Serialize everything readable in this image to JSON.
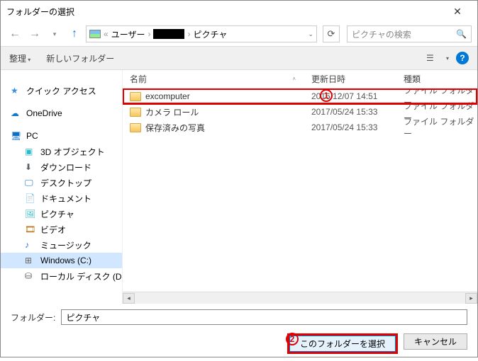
{
  "window": {
    "title": "フォルダーの選択"
  },
  "nav": {
    "path_prefix": "«",
    "path_group": "ユーザー",
    "path_sep": "›",
    "path_current": "ピクチャ",
    "search_placeholder": "ピクチャの検索"
  },
  "toolbar": {
    "organize": "整理",
    "new_folder": "新しいフォルダー",
    "help": "?"
  },
  "columns": {
    "name": "名前",
    "date": "更新日時",
    "type": "種類"
  },
  "tree": [
    {
      "icon": "star",
      "label": "クイック アクセス",
      "indent": 0
    },
    {
      "icon": "cloud",
      "label": "OneDrive",
      "indent": 0,
      "gap": true
    },
    {
      "icon": "pc",
      "label": "PC",
      "indent": 0,
      "gap": true
    },
    {
      "icon": "obj3d",
      "label": "3D オブジェクト",
      "indent": 1
    },
    {
      "icon": "download",
      "label": "ダウンロード",
      "indent": 1
    },
    {
      "icon": "desktop",
      "label": "デスクトップ",
      "indent": 1
    },
    {
      "icon": "doc",
      "label": "ドキュメント",
      "indent": 1
    },
    {
      "icon": "pic",
      "label": "ピクチャ",
      "indent": 1
    },
    {
      "icon": "vid",
      "label": "ビデオ",
      "indent": 1
    },
    {
      "icon": "music",
      "label": "ミュージック",
      "indent": 1
    },
    {
      "icon": "win",
      "label": "Windows (C:)",
      "indent": 1,
      "selected": true
    },
    {
      "icon": "disk",
      "label": "ローカル ディスク (D",
      "indent": 1
    }
  ],
  "rows": [
    {
      "name": "excomputer",
      "date": "2016/12/07 14:51",
      "type": "ファイル フォルダー",
      "highlight": true
    },
    {
      "name": "カメラ ロール",
      "date": "2017/05/24 15:33",
      "type": "ファイル フォルダー"
    },
    {
      "name": "保存済みの写真",
      "date": "2017/05/24 15:33",
      "type": "ファイル フォルダー"
    }
  ],
  "annotations": {
    "a1": "1",
    "a2": "2"
  },
  "folder": {
    "label": "フォルダー:",
    "value": "ピクチャ"
  },
  "buttons": {
    "select": "このフォルダーを選択",
    "cancel": "キャンセル"
  }
}
